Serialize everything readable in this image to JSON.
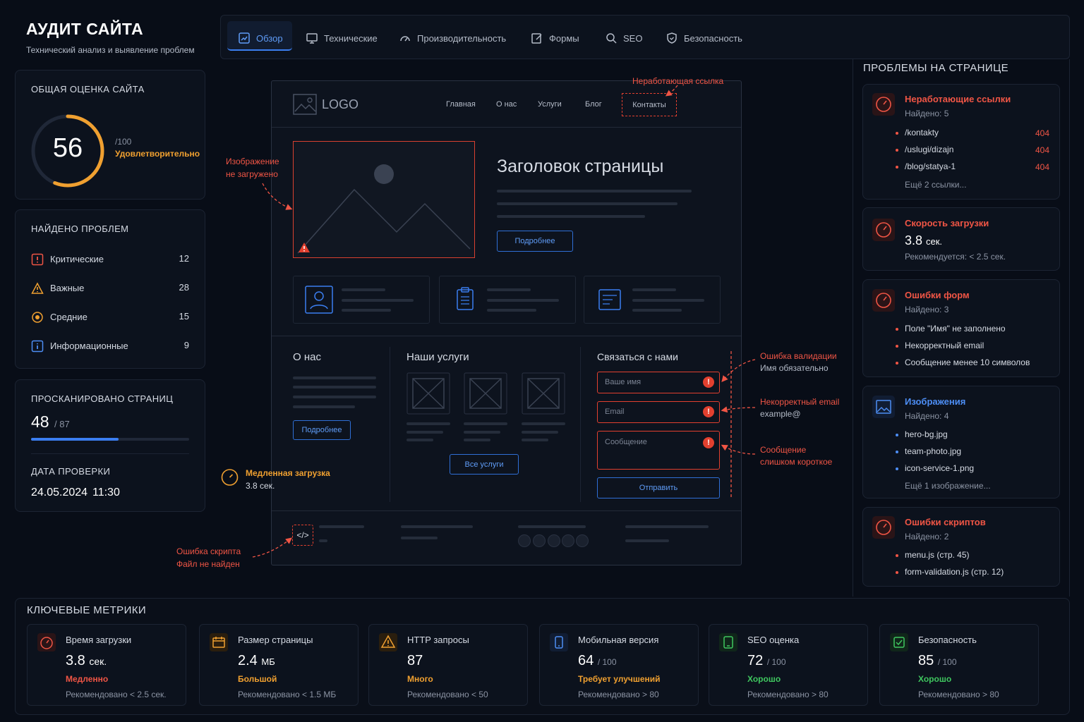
{
  "header": {
    "title": "АУДИТ САЙТА",
    "subtitle": "Технический анализ и выявление проблем"
  },
  "tabs": [
    {
      "label": "Обзор",
      "icon": "chart-icon",
      "active": true
    },
    {
      "label": "Технические",
      "icon": "monitor-icon"
    },
    {
      "label": "Производительность",
      "icon": "gauge-icon"
    },
    {
      "label": "Формы",
      "icon": "edit-form-icon"
    },
    {
      "label": "SEO",
      "icon": "search-icon"
    },
    {
      "label": "Безопасность",
      "icon": "shield-icon"
    }
  ],
  "score": {
    "heading": "ОБЩАЯ ОЦЕНКА САЙТА",
    "value": "56",
    "max": "/100",
    "status": "Удовлетворительно",
    "fraction": 0.56,
    "color": "#f0a030"
  },
  "issues": {
    "heading": "НАЙДЕНО ПРОБЛЕМ",
    "rows": [
      {
        "label": "Критические",
        "count": "12",
        "color": "#f05545"
      },
      {
        "label": "Важные",
        "count": "28",
        "color": "#f0a030"
      },
      {
        "label": "Средние",
        "count": "15",
        "color": "#f0a030"
      },
      {
        "label": "Информационные",
        "count": "9",
        "color": "#4d8ef5"
      }
    ]
  },
  "scan": {
    "heading": "ПРОСКАНИРОВАНО СТРАНИЦ",
    "value": "48",
    "total": "/ 87",
    "fraction": 0.552,
    "date_heading": "ДАТА ПРОВЕРКИ",
    "date": "24.05.2024",
    "time": "11:30"
  },
  "mock": {
    "logo": "LOGO",
    "nav": [
      "Главная",
      "О нас",
      "Услуги",
      "Блог",
      "Контакты"
    ],
    "page_title": "Заголовок страницы",
    "more_button": "Подробнее",
    "about_title": "О нас",
    "about_button": "Подробнее",
    "services_title": "Наши услуги",
    "services_button": "Все услуги",
    "contact_title": "Связаться с нами",
    "name_placeholder": "Ваше имя",
    "email_placeholder": "Email",
    "message_placeholder": "Сообщение",
    "submit": "Отправить"
  },
  "annotations": {
    "broken_link": "Неработающая ссылка",
    "image_l1": "Изображение",
    "image_l2": "не загружено",
    "validation_l1": "Ошибка валидации",
    "validation_l2": "Имя обязательно",
    "email_l1": "Некорректный email",
    "email_l2": "example@",
    "message_l1": "Сообщение",
    "message_l2": "слишком короткое",
    "slow_l1": "Медленная загрузка",
    "slow_l2": "3.8 сек.",
    "script_l1": "Ошибка скрипта",
    "script_l2": "Файл не найден"
  },
  "problems": {
    "heading": "ПРОБЛЕМЫ НА СТРАНИЦЕ",
    "links": {
      "title": "Неработающие ссылки",
      "found": "Найдено: 5",
      "items": [
        {
          "path": "/kontakty",
          "code": "404"
        },
        {
          "path": "/uslugi/dizajn",
          "code": "404"
        },
        {
          "path": "/blog/statya-1",
          "code": "404"
        }
      ],
      "more": "Ещё 2 ссылки..."
    },
    "speed": {
      "title": "Скорость загрузки",
      "value": "3.8",
      "unit": "сек.",
      "rec": "Рекомендуется: < 2.5 сек."
    },
    "forms": {
      "title": "Ошибки форм",
      "found": "Найдено: 3",
      "items": [
        "Поле \"Имя\" не заполнено",
        "Некорректный email",
        "Сообщение менее 10 символов"
      ]
    },
    "images": {
      "title": "Изображения",
      "found": "Найдено: 4",
      "items": [
        "hero-bg.jpg",
        "team-photo.jpg",
        "icon-service-1.png"
      ],
      "more": "Ещё 1 изображение..."
    },
    "scripts": {
      "title": "Ошибки скриптов",
      "found": "Найдено: 2",
      "items": [
        "menu.js (стр. 45)",
        "form-validation.js (стр. 12)"
      ]
    }
  },
  "metrics": {
    "heading": "КЛЮЧЕВЫЕ МЕТРИКИ",
    "items": [
      {
        "label": "Время загрузки",
        "value": "3.8",
        "unit": "сек.",
        "status": "Медленно",
        "status_color": "#f05545",
        "rec": "Рекомендовано < 2.5 сек.",
        "icon": "stopwatch-icon"
      },
      {
        "label": "Размер страницы",
        "value": "2.4",
        "unit": "МБ",
        "status": "Большой",
        "status_color": "#f0a030",
        "rec": "Рекомендовано < 1.5 МБ",
        "icon": "calendar-icon"
      },
      {
        "label": "HTTP запросы",
        "value": "87",
        "unit": "",
        "status": "Много",
        "status_color": "#f0a030",
        "rec": "Рекомендовано < 50",
        "icon": "warning-icon"
      },
      {
        "label": "Мобильная версия",
        "value": "64",
        "unit": "/ 100",
        "status": "Требует улучшений",
        "status_color": "#f0a030",
        "rec": "Рекомендовано > 80",
        "icon": "mobile-icon"
      },
      {
        "label": "SEO оценка",
        "value": "72",
        "unit": "/ 100",
        "status": "Хорошо",
        "status_color": "#3fc75f",
        "rec": "Рекомендовано > 80",
        "icon": "seo-icon"
      },
      {
        "label": "Безопасность",
        "value": "85",
        "unit": "/ 100",
        "status": "Хорошо",
        "status_color": "#3fc75f",
        "rec": "Рекомендовано > 80",
        "icon": "lock-icon"
      }
    ]
  }
}
